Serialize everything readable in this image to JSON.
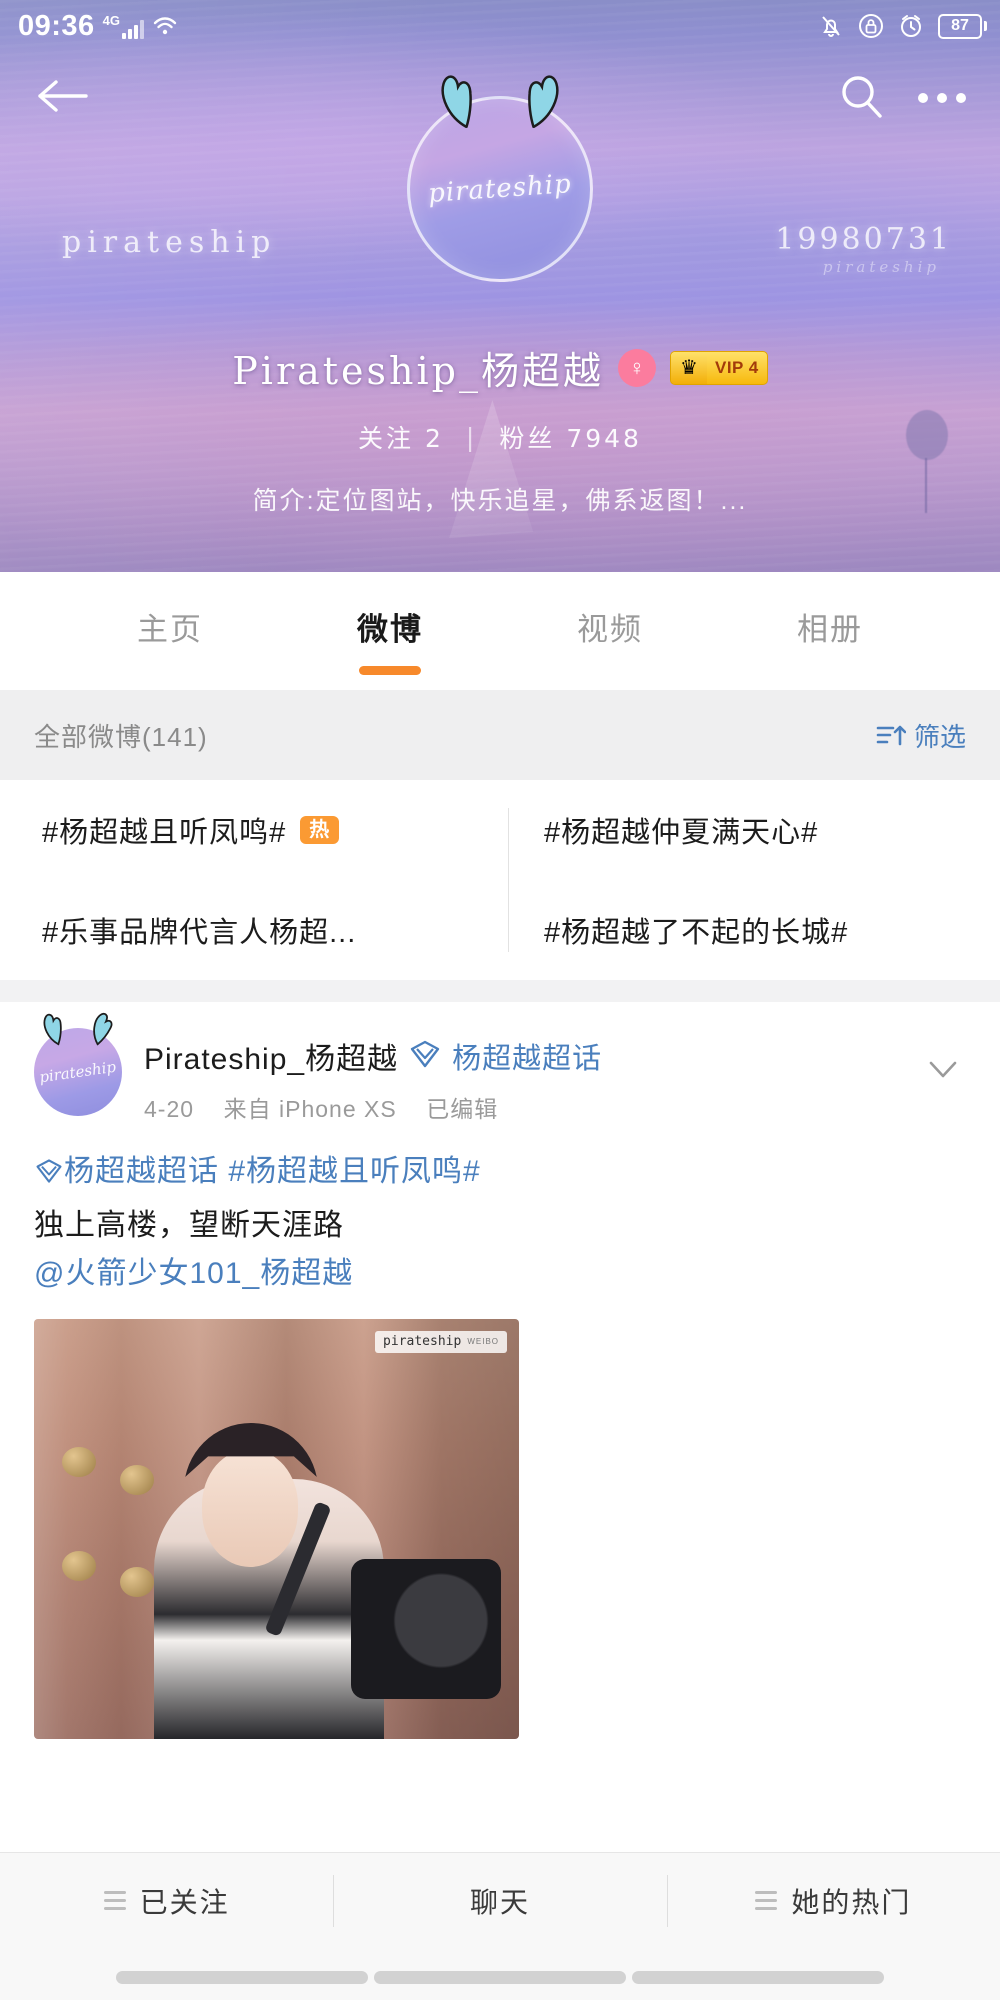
{
  "status_bar": {
    "time": "09:36",
    "network_label": "4G",
    "battery_level": "87",
    "icons": [
      "signal-bars-icon",
      "wifi-icon",
      "mute-bell-icon",
      "lock-icon",
      "alarm-clock-icon",
      "battery-icon"
    ]
  },
  "nav": {
    "back_icon": "back-arrow-icon",
    "search_icon": "search-icon",
    "more_icon": "more-dots-icon"
  },
  "banner": {
    "word_left": "pirateship",
    "word_right": "19980731",
    "word_right_sub": "pirateship",
    "avatar_text": "pirateship"
  },
  "profile": {
    "name": "Pirateship_杨超越",
    "gender_symbol": "♀",
    "vip_crown": "♛",
    "vip_label": "VIP 4",
    "following_label": "关注",
    "following_count": "2",
    "separator": "|",
    "fans_label": "粉丝",
    "fans_count": "7948",
    "intro": "简介:定位图站，快乐追星，佛系返图！..."
  },
  "tabs": [
    {
      "label": "主页",
      "active": false
    },
    {
      "label": "微博",
      "active": true
    },
    {
      "label": "视频",
      "active": false
    },
    {
      "label": "相册",
      "active": false
    }
  ],
  "filter_bar": {
    "count_label": "全部微博(141)",
    "filter_label": "筛选",
    "sort_icon": "sort-ascending-icon"
  },
  "topics": [
    {
      "text": "#杨超越且听凤鸣#",
      "badge": "热"
    },
    {
      "text": "#杨超越仲夏满天心#",
      "badge": ""
    },
    {
      "text": "#乐事品牌代言人杨超...",
      "badge": ""
    },
    {
      "text": "#杨超越了不起的长城#",
      "badge": ""
    }
  ],
  "post": {
    "avatar_text": "pirateship",
    "author": "Pirateship_杨超越",
    "supertopic": "杨超越超话",
    "supertopic_icon": "supertopic-diamond-icon",
    "date": "4-20",
    "source": "来自 iPhone XS",
    "edited": "已编辑",
    "chevron_icon": "chevron-down-icon",
    "body_topic": "杨超越超话 #杨超越且听凤鸣#",
    "body_line2": "独上高楼，望断天涯路",
    "body_mention": "@火箭少女101_杨超越",
    "image_watermark": "pirateship",
    "image_watermark_sub": "WEIBO"
  },
  "bottom_bar": [
    {
      "label": "已关注",
      "icon": "list-icon"
    },
    {
      "label": "聊天",
      "icon": ""
    },
    {
      "label": "她的热门",
      "icon": "list-icon"
    }
  ],
  "colors": {
    "accent_orange": "#f7892b",
    "link_blue": "#4a7fbd",
    "hot_badge": "#fb9a33",
    "vip_gold": "#f7b90d",
    "gender_pink": "#fb7c9e"
  }
}
